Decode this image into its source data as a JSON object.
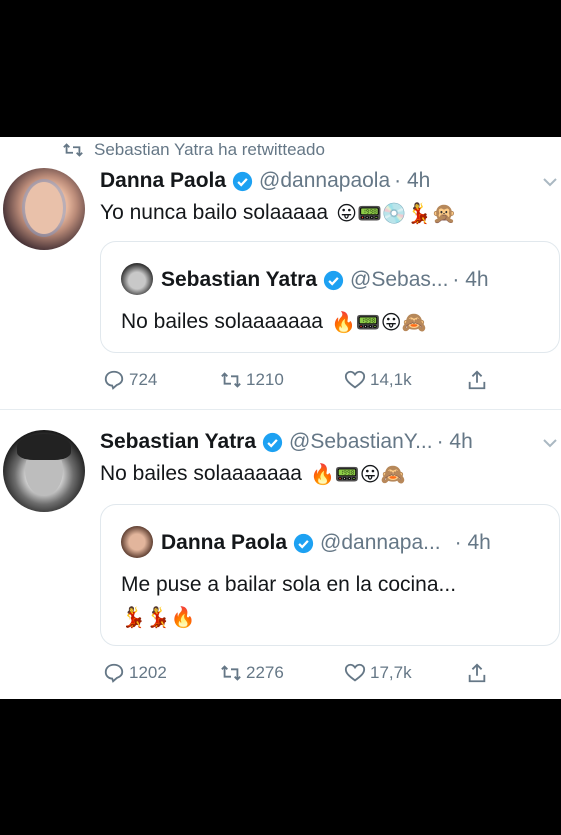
{
  "retweet_line": {
    "text": "Sebastian Yatra ha retwitteado"
  },
  "tweet1": {
    "name": "Danna Paola",
    "handle": "@dannapaola",
    "time": "· 4h",
    "text": "Yo nunca bailo solaaaaa",
    "emojis": "😛📟💿💃🙊",
    "quote": {
      "name": "Sebastian Yatra",
      "handle": "@Sebas...",
      "time": "· 4h",
      "text": "No bailes solaaaaaaa",
      "emojis": "🔥📟😛🙈"
    },
    "actions": {
      "replies": "724",
      "retweets": "1210",
      "likes": "14,1k"
    }
  },
  "tweet2": {
    "name": "Sebastian Yatra",
    "handle": "@SebastianY...",
    "time": "· 4h",
    "text": "No bailes solaaaaaaa",
    "emojis": "🔥📟😛🙈",
    "quote": {
      "name": "Danna Paola",
      "handle": "@dannapa...",
      "time": "· 4h",
      "text": "Me puse a bailar sola en la cocina...",
      "emojis": "💃💃🔥"
    },
    "actions": {
      "replies": "1202",
      "retweets": "2276",
      "likes": "17,7k"
    }
  },
  "colors": {
    "accent": "#1da1f2",
    "muted": "#657786",
    "text": "#14171a",
    "divider": "#e6ecf0"
  }
}
